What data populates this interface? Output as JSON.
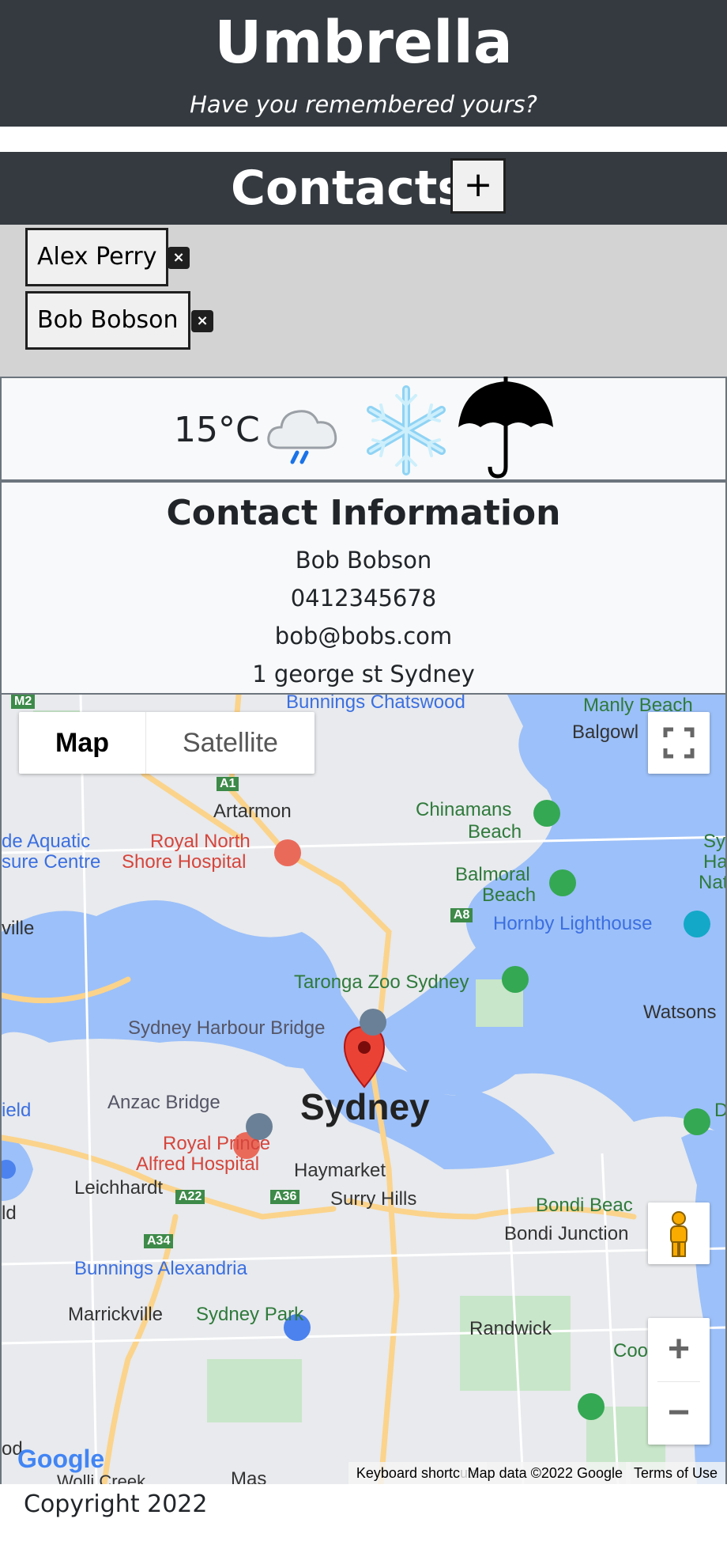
{
  "header": {
    "title": "Umbrella",
    "subtitle": "Have you remembered yours?"
  },
  "contacts": {
    "heading": "Contacts",
    "add_label": "+",
    "remove_label": "×",
    "items": [
      {
        "name": "Alex Perry"
      },
      {
        "name": "Bob Bobson"
      }
    ]
  },
  "weather": {
    "temperature": "15°C",
    "icons": [
      "rain-cloud-icon",
      "snowflake-icon",
      "umbrella-icon"
    ]
  },
  "contact_info": {
    "title": "Contact Information",
    "name": "Bob Bobson",
    "phone": "0412345678",
    "email": "bob@bobs.com",
    "address": "1 george st Sydney"
  },
  "map": {
    "type_map": "Map",
    "type_satellite": "Satellite",
    "zoom_in": "+",
    "zoom_out": "−",
    "logo": "Google",
    "attribution": {
      "shortcuts": "Keyboard shortcuts",
      "data": "Map data ©2022 Google",
      "terms": "Terms of Use"
    },
    "labels": {
      "m2": "M2",
      "bunnings_chatswood": "Bunnings Chatswood",
      "manly_beach": "Manly Beach",
      "balgowlah": "Balgowl",
      "a1": "A1",
      "artarmon": "Artarmon",
      "chinamans_beach_1": "Chinamans",
      "chinamans_beach_2": "Beach",
      "aquatic_1": "de Aquatic",
      "aquatic_2": "sure Centre",
      "royal_north_1": "Royal North",
      "royal_north_2": "Shore Hospital",
      "balmoral_1": "Balmoral",
      "balmoral_2": "Beach",
      "sy_1": "Sy",
      "ha": "Ha",
      "nation": "Natio",
      "ville": "ville",
      "a8": "A8",
      "hornby": "Hornby Lighthouse",
      "taronga": "Taronga Zoo Sydney",
      "watsons": "Watsons",
      "harbour_bridge": "Sydney Harbour Bridge",
      "anzac": "Anzac Bridge",
      "sydney": "Sydney",
      "ield": "ield",
      "royal_prince_1": "Royal Prince",
      "royal_prince_2": "Alfred Hospital",
      "haymarket": "Haymarket",
      "leichhardt": "Leichhardt",
      "a22": "A22",
      "a36": "A36",
      "surry_hills": "Surry Hills",
      "bondi_beach": "Bondi Beac",
      "bondi_junction": "Bondi Junction",
      "ld": "ld",
      "a34": "A34",
      "bunnings_alexandria": "Bunnings Alexandria",
      "marrickville": "Marrickville",
      "sydney_park": "Sydney Park",
      "randwick": "Randwick",
      "coogee": "Coo",
      "wolli": "Wolli Creek",
      "mascot": "Mas",
      "od": "od",
      "d": "D"
    }
  },
  "footer": {
    "copyright": "Copyright 2022"
  }
}
